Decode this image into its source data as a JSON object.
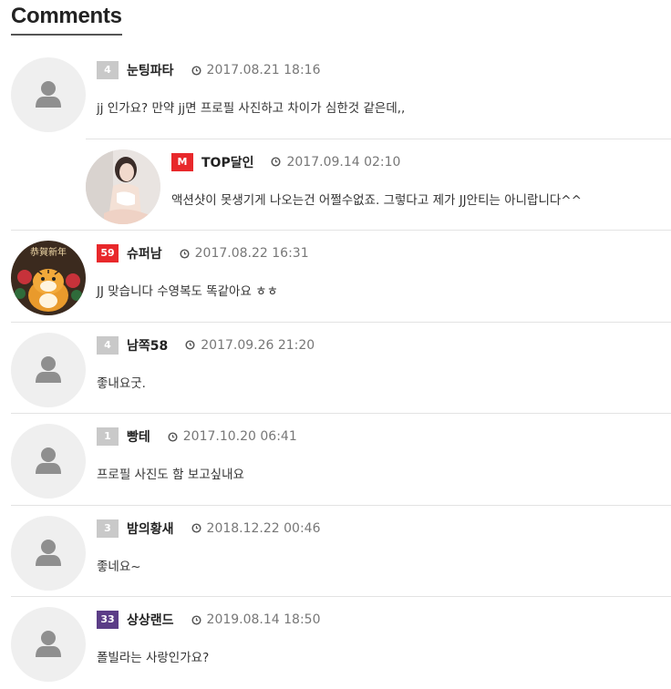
{
  "section_title": "Comments",
  "comments": [
    {
      "type": "top",
      "avatar": "default",
      "badge": "4",
      "badge_color": "#c9c9c9",
      "author": "눈팅파타",
      "date": "2017.08.21 18:16",
      "text": "jj 인가요? 만약 jj면 프로필 사진하고 차이가 심한것 같은데,,"
    },
    {
      "type": "reply",
      "avatar": "photo-woman",
      "badge": "M",
      "badge_color": "#e8282b",
      "author": "TOP달인",
      "date": "2017.09.14 02:10",
      "text": "액션샷이 못생기게 나오는건 어쩔수없죠. 그렇다고 제가 JJ안티는 아니랍니다^^"
    },
    {
      "type": "top",
      "avatar": "tiger-illustration",
      "badge": "59",
      "badge_color": "#e8282b",
      "author": "슈퍼남",
      "date": "2017.08.22 16:31",
      "text": "JJ 맞습니다 수영복도 똑같아요 ㅎㅎ"
    },
    {
      "type": "top",
      "avatar": "default",
      "badge": "4",
      "badge_color": "#c9c9c9",
      "author": "남쪽58",
      "date": "2017.09.26 21:20",
      "text": "좋내요굿."
    },
    {
      "type": "top",
      "avatar": "default",
      "badge": "1",
      "badge_color": "#c9c9c9",
      "author": "빵테",
      "date": "2017.10.20 06:41",
      "text": "프로필 사진도 함 보고싶내요"
    },
    {
      "type": "top",
      "avatar": "default",
      "badge": "3",
      "badge_color": "#c9c9c9",
      "author": "밤의황새",
      "date": "2018.12.22 00:46",
      "text": "좋네요~"
    },
    {
      "type": "top",
      "avatar": "default",
      "badge": "33",
      "badge_color": "#5b3d87",
      "author": "상상랜드",
      "date": "2019.08.14 18:50",
      "text": "폴빌라는 사랑인가요?"
    }
  ],
  "icons": {
    "clock": "clock-icon",
    "default_avatar": "user-silhouette-icon"
  }
}
